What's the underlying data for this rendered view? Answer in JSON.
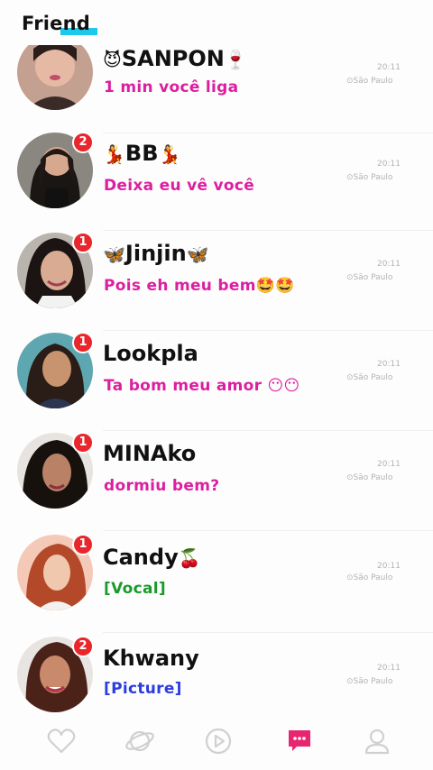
{
  "header": {
    "title": "Friend"
  },
  "chats": [
    {
      "name_prefix": "😈",
      "name": "SANPON",
      "name_suffix": "🍷",
      "message": "1 min você liga",
      "message_type": "text",
      "time": "20:11",
      "location": "São Paulo",
      "unread": ""
    },
    {
      "name_prefix": "💃",
      "name": "BB",
      "name_suffix": "💃",
      "message": "Deixa eu vê você",
      "message_type": "text",
      "time": "20:11",
      "location": "São Paulo",
      "unread": "2"
    },
    {
      "name_prefix": "🦋",
      "name": "Jinjin",
      "name_suffix": "🦋",
      "message": "Pois eh meu bem🤩🤩",
      "message_type": "text",
      "time": "20:11",
      "location": "São Paulo",
      "unread": "1"
    },
    {
      "name_prefix": "",
      "name": "Lookpla",
      "name_suffix": "",
      "message": "Ta bom meu amor 😶😶",
      "message_type": "text",
      "time": "20:11",
      "location": "São Paulo",
      "unread": "1"
    },
    {
      "name_prefix": "",
      "name": "MINAko",
      "name_suffix": "",
      "message": "dormiu bem?",
      "message_type": "text",
      "time": "20:11",
      "location": "São Paulo",
      "unread": "1"
    },
    {
      "name_prefix": "",
      "name": "Candy",
      "name_suffix": "🍒",
      "message": "[Vocal]",
      "message_type": "vocal",
      "time": "20:11",
      "location": "São Paulo",
      "unread": "1"
    },
    {
      "name_prefix": "",
      "name": "Khwany",
      "name_suffix": "",
      "message": "[Picture]",
      "message_type": "picture",
      "time": "20:11",
      "location": "São Paulo",
      "unread": "2"
    }
  ],
  "tabs": [
    {
      "icon": "heart-icon"
    },
    {
      "icon": "planet-icon"
    },
    {
      "icon": "play-icon"
    },
    {
      "icon": "chat-icon",
      "active": true
    },
    {
      "icon": "profile-icon"
    }
  ],
  "colors": {
    "accent_cyan": "#1ec8ea",
    "badge_red": "#e8262c",
    "message_pink": "#dc1ea0",
    "vocal_green": "#1a9a2a",
    "picture_blue": "#2b3ce0",
    "active_tab": "#e8266f",
    "inactive_tab": "#d0d0d0"
  }
}
